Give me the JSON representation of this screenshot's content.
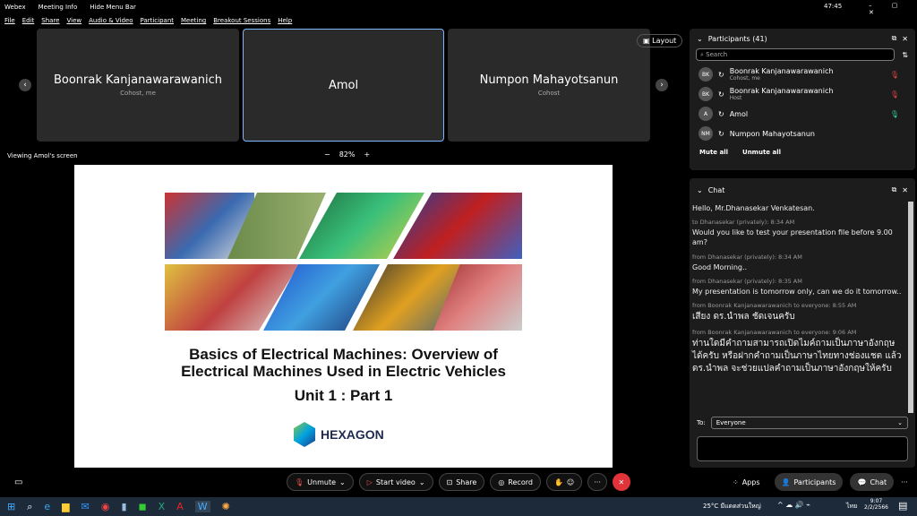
{
  "titlebar": {
    "app": "Webex",
    "meeting_info": "Meeting Info",
    "hide_menu": "Hide Menu Bar",
    "time": "47:45"
  },
  "menu": [
    "File",
    "Edit",
    "Share",
    "View",
    "Audio & Video",
    "Participant",
    "Meeting",
    "Breakout Sessions",
    "Help"
  ],
  "tiles": [
    {
      "name": "Boonrak Kanjanawarawanich",
      "sub": "Cohost, me"
    },
    {
      "name": "Amol",
      "sub": ""
    },
    {
      "name": "Numpon Mahayotsanun",
      "sub": "Cohost"
    }
  ],
  "layout_label": "Layout",
  "viewing": "Viewing Amol's screen",
  "zoom": "82%",
  "slide": {
    "title1": "Basics of Electrical Machines: Overview of",
    "title2": "Electrical Machines Used in Electric Vehicles",
    "unit": "Unit 1 : Part 1",
    "logo": "HEXAGON"
  },
  "participants": {
    "title": "Participants (41)",
    "search_placeholder": "Search",
    "items": [
      {
        "initials": "BK",
        "name": "Boonrak Kanjanawarawanich",
        "role": "Cohost, me"
      },
      {
        "initials": "BK",
        "name": "Boonrak Kanjanawarawanich",
        "role": "Host"
      },
      {
        "initials": "A",
        "name": "Amol",
        "role": ""
      },
      {
        "initials": "NM",
        "name": "Numpon Mahayotsanun",
        "role": ""
      }
    ],
    "mute_all": "Mute all",
    "unmute_all": "Unmute all"
  },
  "chat": {
    "title": "Chat",
    "messages": [
      {
        "meta": "",
        "text": "Hello, Mr.Dhanasekar Venkatesan."
      },
      {
        "meta": "to Dhanasekar (privately):   8:34 AM",
        "text": "Would you like to test your presentation file before 9.00 am?"
      },
      {
        "meta": "from Dhanasekar (privately):   8:34 AM",
        "text": "Good Morning.."
      },
      {
        "meta": "from Dhanasekar (privately):   8:35 AM",
        "text": "My presentation is tomorrow only, can we do it tomorrow.."
      },
      {
        "meta": "from Boonrak Kanjanawarawanich to everyone:   8:55 AM",
        "text": "เสียง ดร.นำพล ชัดเจนครับ"
      },
      {
        "meta": "from Boonrak Kanjanawarawanich to everyone:   9:06 AM",
        "text": "ท่านใดมีคำถามสามารถเปิดไมค์ถามเป็นภาษาอังกฤษได้ครับ หรือฝากคำถามเป็นภาษาไทยทางช่องแชต แล้ว ดร.นำพล จะช่วยแปลคำถามเป็นภาษาอังกฤษให้ครับ"
      }
    ],
    "to_label": "To:",
    "to_value": "Everyone"
  },
  "controls": {
    "unmute": "Unmute",
    "start_video": "Start video",
    "share": "Share",
    "record": "Record",
    "apps": "Apps",
    "participants": "Participants",
    "chat": "Chat"
  },
  "taskbar": {
    "weather": "25°C มีแดดส่วนใหญ่",
    "lang": "ไทย",
    "time": "9:07",
    "date": "2/2/2566"
  },
  "colors": {
    "accent": "#4a9eff",
    "end": "#e0343a"
  }
}
